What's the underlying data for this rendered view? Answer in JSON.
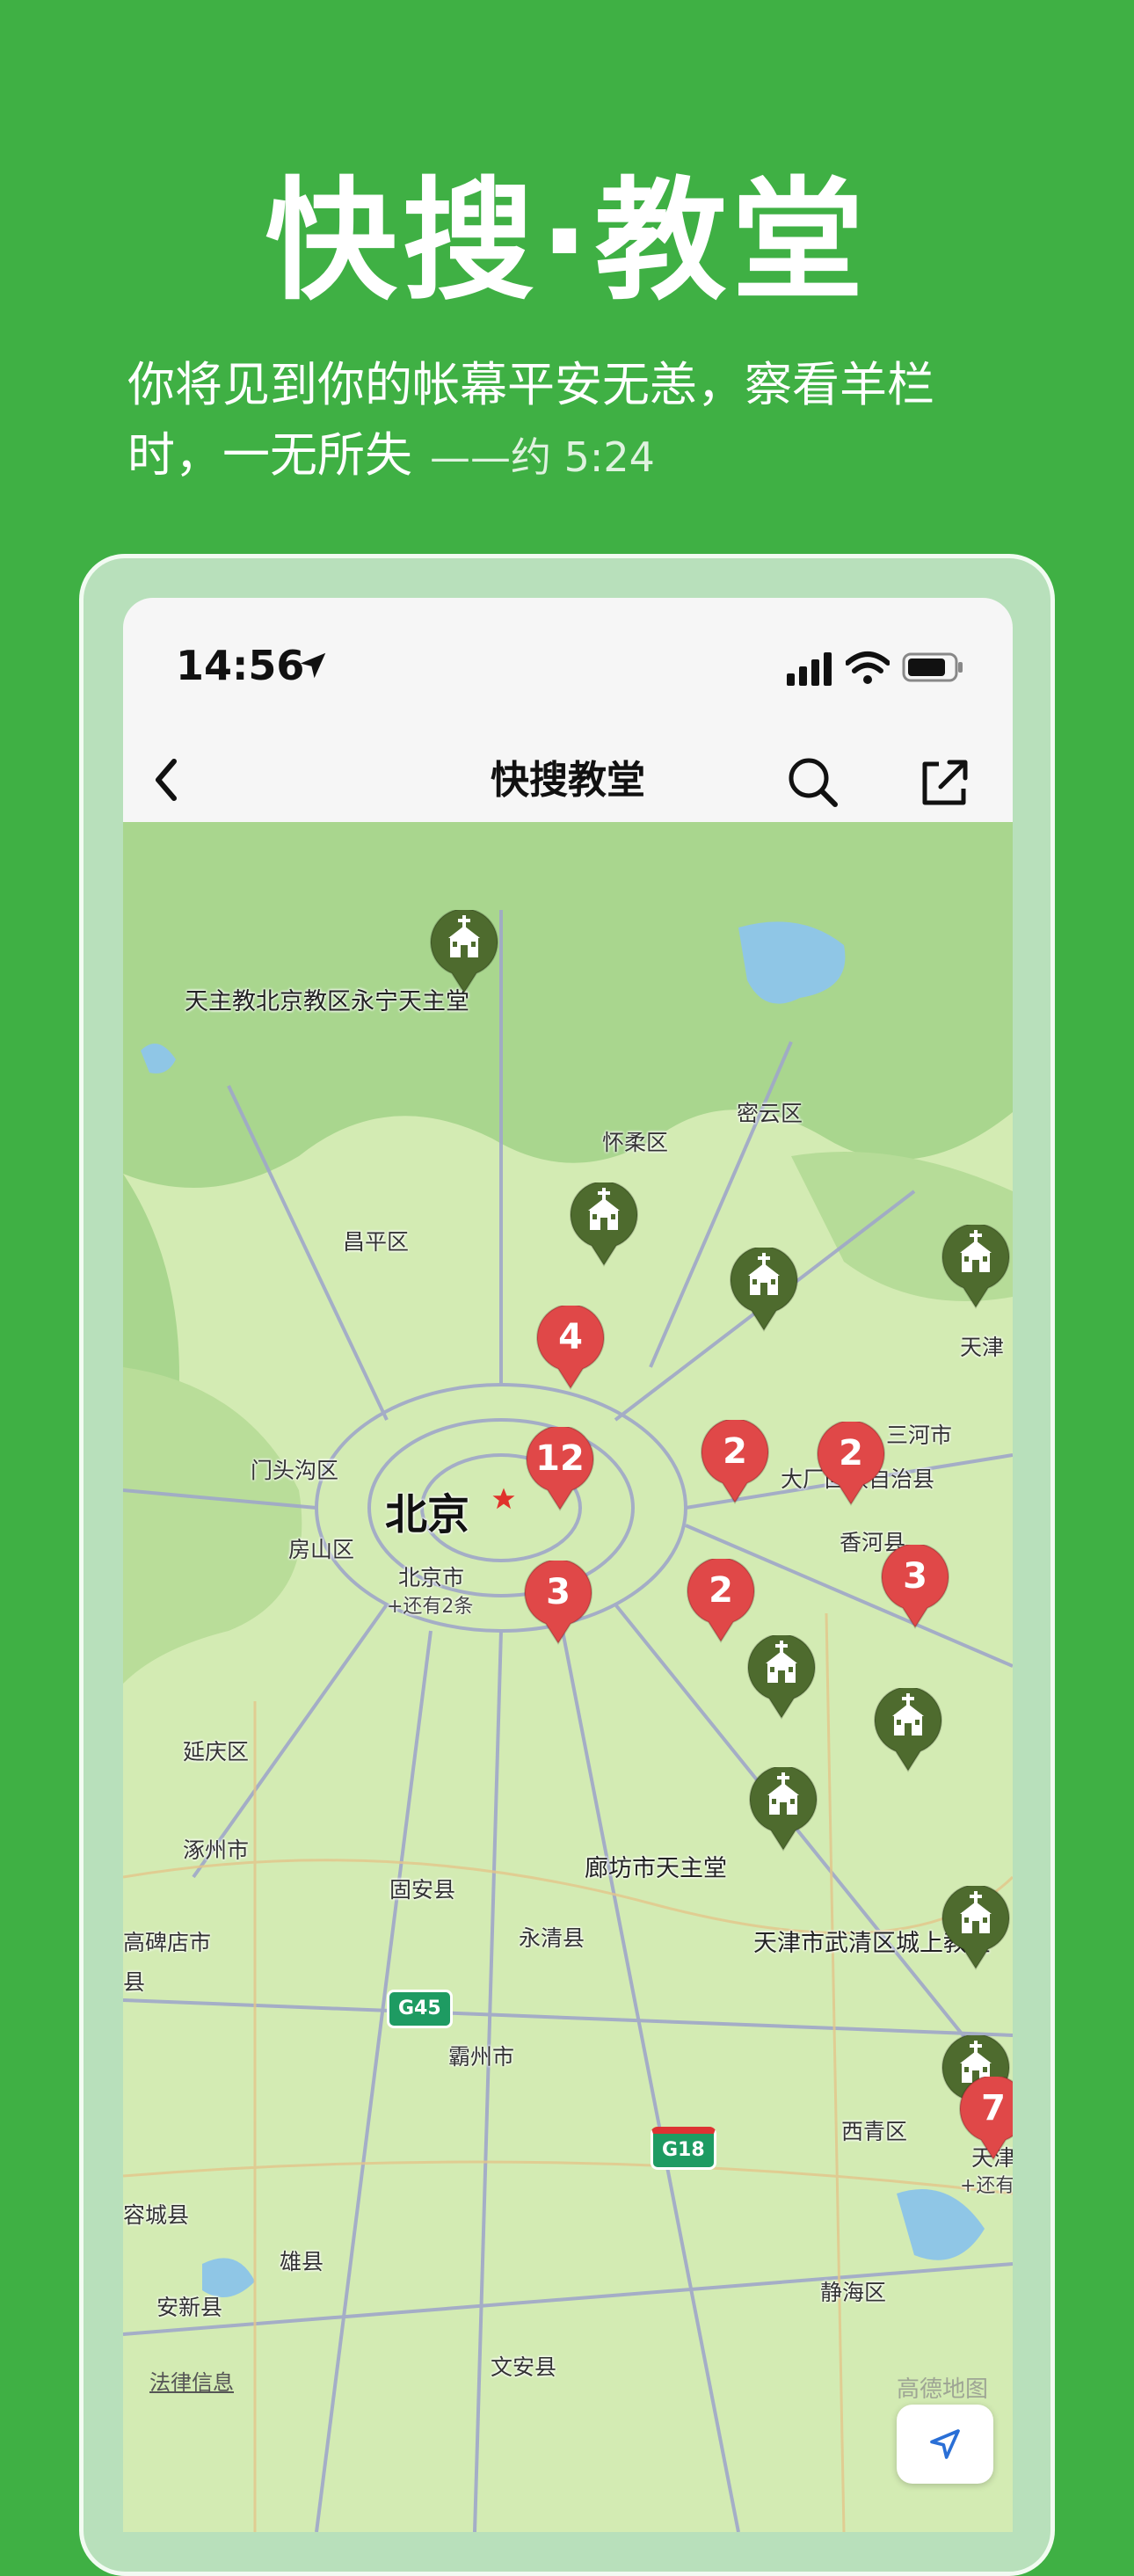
{
  "headline": "快搜·教堂",
  "quote": {
    "text": "你将见到你的帐幕平安无恙，察看羊栏时，一无所失",
    "reference": "——约 5:24"
  },
  "statusbar": {
    "time": "14:56"
  },
  "navbar": {
    "title": "快搜教堂"
  },
  "map": {
    "labels": {
      "yanqing": "延庆区",
      "miyun": "密云区",
      "huairou": "怀柔区",
      "changping": "昌平区",
      "tianjin_edge": "天津",
      "sanhe": "三河市",
      "mentougou": "门头沟区",
      "beijing": "北京",
      "dachang": "大厂回族自治县",
      "xianghe": "香河县",
      "fangshan": "房山区",
      "beijing_city": "北京市",
      "more_two": "+还有2条",
      "zhuozhou": "涿州市",
      "gu_an": "固安县",
      "yongqing": "永清县",
      "gaobeidian": "高碑店市",
      "xian": "县",
      "bazhou": "霸州市",
      "xiqing": "西青区",
      "tianjin2": "天津",
      "more_short": "+还有",
      "rongcheng": "容城县",
      "xiongxian": "雄县",
      "anxin": "安新县",
      "jinghai": "静海区",
      "wenan": "文安县"
    },
    "poi": {
      "yongning": "天主教北京教区永宁天主堂",
      "langfang": "廊坊市天主堂",
      "wuqing": "天津市武清区城上教堂"
    },
    "clusters": {
      "c4": "4",
      "c12": "12",
      "c2a": "2",
      "c2b": "2",
      "c3a": "3",
      "c2c": "2",
      "c3b": "3",
      "c7": "7"
    },
    "shields": {
      "g45": "G45",
      "g18": "G18"
    },
    "legal": "法律信息",
    "watermark": "高德地图"
  },
  "colors": {
    "background": "#3fb044",
    "church_pin": "#4e6b2e",
    "cluster_pin": "#e04848",
    "map_land": "#cfe8b0"
  }
}
